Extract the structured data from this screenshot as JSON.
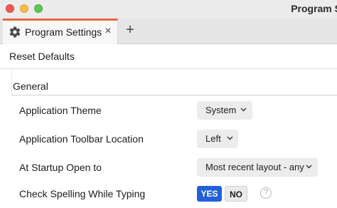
{
  "window": {
    "title": "Program S"
  },
  "tabs": [
    {
      "label": "Program Settings",
      "icon": "gear-icon",
      "close": "×"
    }
  ],
  "new_tab": "+",
  "toolbar": {
    "reset_label": "Reset Defaults"
  },
  "section": {
    "title": "General",
    "settings": [
      {
        "label": "Application Theme",
        "value": "System"
      },
      {
        "label": "Application Toolbar Location",
        "value": "Left"
      },
      {
        "label": "At Startup Open to",
        "value": "Most recent layout - any"
      },
      {
        "label": "Check Spelling While Typing",
        "options": [
          "YES",
          "NO"
        ],
        "selected": "YES",
        "help": "?"
      }
    ]
  },
  "colors": {
    "accent": "#2160d9",
    "tab_accent": "#e8663d"
  }
}
